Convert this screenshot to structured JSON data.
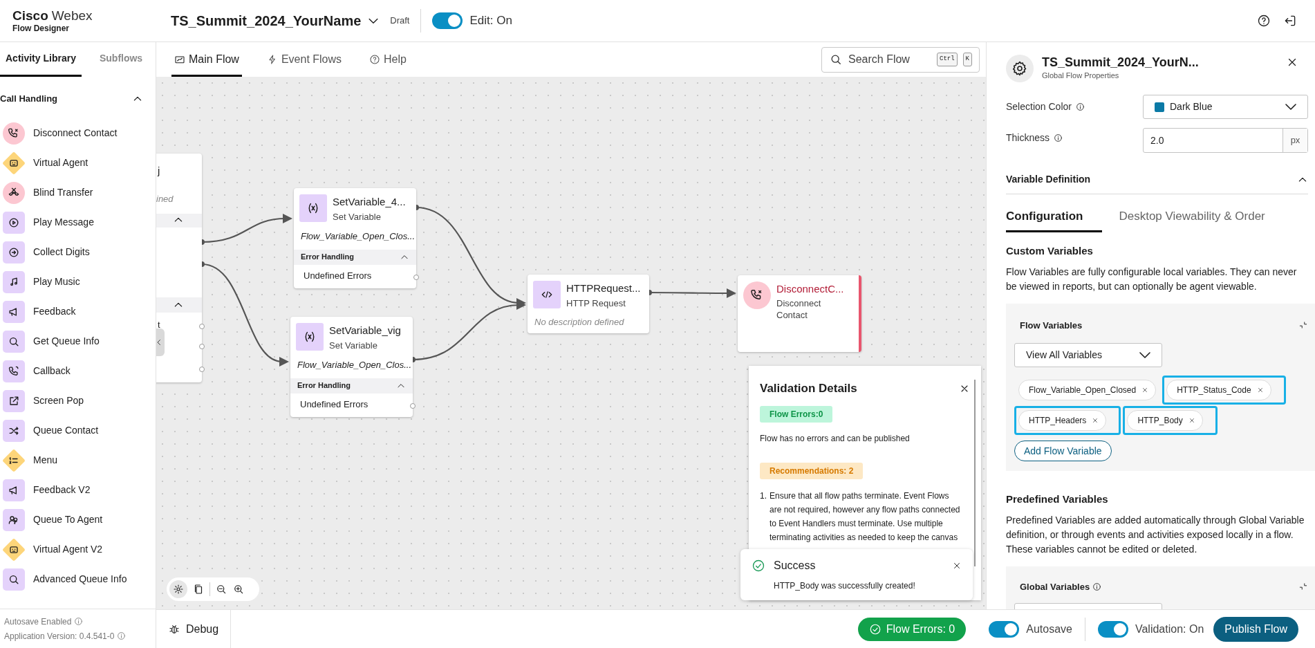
{
  "header": {
    "brand": "Cisco",
    "product": "Webex",
    "app": "Flow Designer",
    "flow_name": "TS_Summit_2024_YourName",
    "status": "Draft",
    "edit_toggle": {
      "label": "Edit: On",
      "on": true
    }
  },
  "sidebar": {
    "tabs": [
      {
        "label": "Activity Library",
        "selected": true
      },
      {
        "label": "Subflows",
        "selected": false
      }
    ],
    "section": {
      "title": "Call Handling",
      "expanded": true
    },
    "items": [
      {
        "label": "Disconnect Contact",
        "kind": "circle"
      },
      {
        "label": "Virtual Agent",
        "kind": "diamond"
      },
      {
        "label": "Blind Transfer",
        "kind": "circle"
      },
      {
        "label": "Play Message",
        "kind": "square"
      },
      {
        "label": "Collect Digits",
        "kind": "square"
      },
      {
        "label": "Play Music",
        "kind": "square"
      },
      {
        "label": "Feedback",
        "kind": "square"
      },
      {
        "label": "Get Queue Info",
        "kind": "square"
      },
      {
        "label": "Callback",
        "kind": "square"
      },
      {
        "label": "Screen Pop",
        "kind": "square"
      },
      {
        "label": "Queue Contact",
        "kind": "square"
      },
      {
        "label": "Menu",
        "kind": "diamond"
      },
      {
        "label": "Feedback V2",
        "kind": "square"
      },
      {
        "label": "Queue To Agent",
        "kind": "square"
      },
      {
        "label": "Virtual Agent V2",
        "kind": "diamond"
      },
      {
        "label": "Advanced Queue Info",
        "kind": "square"
      }
    ],
    "footer": [
      "Autosave Enabled",
      "Application Version: 0.4.541-0"
    ]
  },
  "canvas_tabs": [
    {
      "label": "Main Flow",
      "selected": true
    },
    {
      "label": "Event Flows",
      "selected": false
    },
    {
      "label": "Help",
      "selected": false
    }
  ],
  "search": {
    "placeholder": "Search Flow",
    "keys": [
      "Ctrl",
      "K"
    ]
  },
  "nodes": [
    {
      "kind": "partial",
      "texts": [
        "j",
        "ined",
        "t"
      ]
    },
    {
      "kind": "activity",
      "title": "SetVariable_4...",
      "type": "Set Variable",
      "description": "Flow_Variable_Open_Clos...",
      "error_handling": "Error Handling",
      "errors": "Undefined Errors"
    },
    {
      "kind": "activity",
      "title": "SetVariable_vig",
      "type": "Set Variable",
      "description": "Flow_Variable_Open_Clos...",
      "error_handling": "Error Handling",
      "errors": "Undefined Errors"
    },
    {
      "kind": "http",
      "title": "HTTPRequest...",
      "type": "HTTP Request",
      "placeholder": "No description defined"
    },
    {
      "kind": "terminal",
      "title": "DisconnectC...",
      "type": "Disconnect Contact",
      "flagged": true
    }
  ],
  "validation": {
    "title": "Validation Details",
    "errors_badge": "Flow Errors:0",
    "errors_text": "Flow has no errors and can be published",
    "recommendations_badge": "Recommendations: 2",
    "recommendations": [
      {
        "number": "1.",
        "text": "Ensure that all flow paths terminate. Event Flows are not required, however any flow paths connected to Event Handlers must terminate. Use multiple terminating activities as needed to keep the canvas"
      }
    ]
  },
  "toast": {
    "title": "Success",
    "message": "HTTP_Body was successfully created!"
  },
  "properties": {
    "title": "TS_Summit_2024_YourN...",
    "subtitle": "Global Flow Properties",
    "selection_color": {
      "label": "Selection Color",
      "value": "Dark Blue",
      "color": "#0b7aa6"
    },
    "thickness": {
      "label": "Thickness",
      "value": "2.0",
      "unit": "px"
    },
    "section": {
      "title": "Variable Definition",
      "expanded": true
    },
    "tabs": [
      {
        "label": "Configuration",
        "selected": true
      },
      {
        "label": "Desktop Viewability & Order",
        "selected": false
      }
    ],
    "custom": {
      "title": "Custom Variables",
      "text": "Flow Variables are fully configurable local variables. They can never be viewed in reports, but can optionally be agent viewable."
    },
    "flow_variables": {
      "title": "Flow Variables",
      "filter": "View All Variables",
      "chips": [
        {
          "label": "Flow_Variable_Open_Closed",
          "highlighted": false
        },
        {
          "label": "HTTP_Status_Code",
          "highlighted": true
        },
        {
          "label": "HTTP_Headers",
          "highlighted": true
        },
        {
          "label": "HTTP_Body",
          "highlighted": true
        }
      ],
      "add_button": "Add Flow Variable"
    },
    "predefined": {
      "title": "Predefined Variables",
      "text": "Predefined Variables are added automatically through Global Variable definition, or through events and activities exposed locally in a flow. These variables cannot be edited or deleted."
    },
    "global_variables": {
      "title": "Global Variables"
    }
  },
  "bottom_bar": {
    "debug": "Debug",
    "flow_errors": "Flow Errors: 0",
    "autosave": {
      "label": "Autosave",
      "on": true
    },
    "validation": {
      "label": "Validation: On",
      "on": true
    },
    "publish": "Publish Flow"
  }
}
